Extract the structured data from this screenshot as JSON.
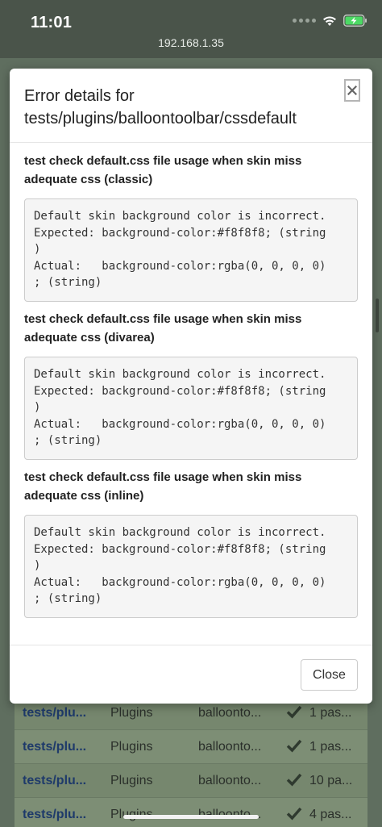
{
  "status_bar": {
    "time": "11:01",
    "url": "192.168.1.35",
    "icons": [
      "signal-dots-icon",
      "wifi-icon",
      "battery-charging-icon"
    ]
  },
  "modal": {
    "title_line1": "Error details for",
    "title_line2": "tests/plugins/balloontoolbar/cssdefault",
    "close_symbol": "×",
    "tests": [
      {
        "title": "test check default.css file usage when skin miss adequate css (classic)",
        "details": "Default skin background color is incorrect.\nExpected: background-color:#f8f8f8; (string\n)\nActual:   background-color:rgba(0, 0, 0, 0)\n; (string)"
      },
      {
        "title": "test check default.css file usage when skin miss adequate css (divarea)",
        "details": "Default skin background color is incorrect.\nExpected: background-color:#f8f8f8; (string\n)\nActual:   background-color:rgba(0, 0, 0, 0)\n; (string)"
      },
      {
        "title": "test check default.css file usage when skin miss adequate css (inline)",
        "details": "Default skin background color is incorrect.\nExpected: background-color:#f8f8f8; (string\n)\nActual:   background-color:rgba(0, 0, 0, 0)\n; (string)"
      }
    ],
    "close_button_label": "Close"
  },
  "background_table": {
    "rows": [
      {
        "path": "tests/plu...",
        "module": "Plugins",
        "name": "balloonto...",
        "result": "1 pas..."
      },
      {
        "path": "tests/plu...",
        "module": "Plugins",
        "name": "balloonto...",
        "result": "1 pas..."
      },
      {
        "path": "tests/plu...",
        "module": "Plugins",
        "name": "balloonto...",
        "result": "10 pa..."
      },
      {
        "path": "tests/plu...",
        "module": "Plugins",
        "name": "balloonto...",
        "result": "4 pas..."
      }
    ]
  },
  "colors": {
    "overlay": "#596859",
    "link": "#1e3a6a",
    "pass_check": "#2f3a2f"
  }
}
